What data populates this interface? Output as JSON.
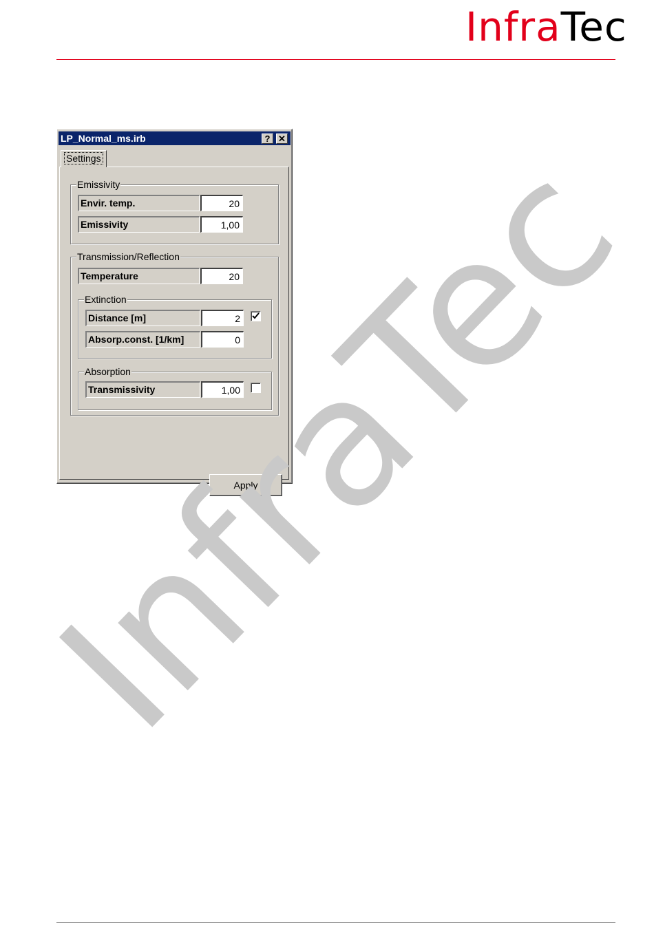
{
  "header": {
    "logo_part1": "Infra",
    "logo_part2": "Tec",
    "brand_color": "#e2001a"
  },
  "watermark": "InfraTec",
  "dialog": {
    "title": "LP_Normal_ms.irb",
    "help_glyph": "?",
    "close_glyph": "✕",
    "tab_label": "Settings",
    "emissivity_group": {
      "legend": "Emissivity",
      "envir_temp_label": "Envir. temp.",
      "envir_temp_value": "20",
      "emissivity_label": "Emissivity",
      "emissivity_value": "1,00"
    },
    "transmission_group": {
      "legend": "Transmission/Reflection",
      "temperature_label": "Temperature",
      "temperature_value": "20",
      "extinction": {
        "legend": "Extinction",
        "distance_label": "Distance [m]",
        "distance_value": "2",
        "distance_checked": true,
        "absorp_label": "Absorp.const. [1/km]",
        "absorp_value": "0"
      },
      "absorption": {
        "legend": "Absorption",
        "transmissivity_label": "Transmissivity",
        "transmissivity_value": "1,00",
        "transmissivity_checked": false
      }
    },
    "apply_label": "Apply"
  }
}
